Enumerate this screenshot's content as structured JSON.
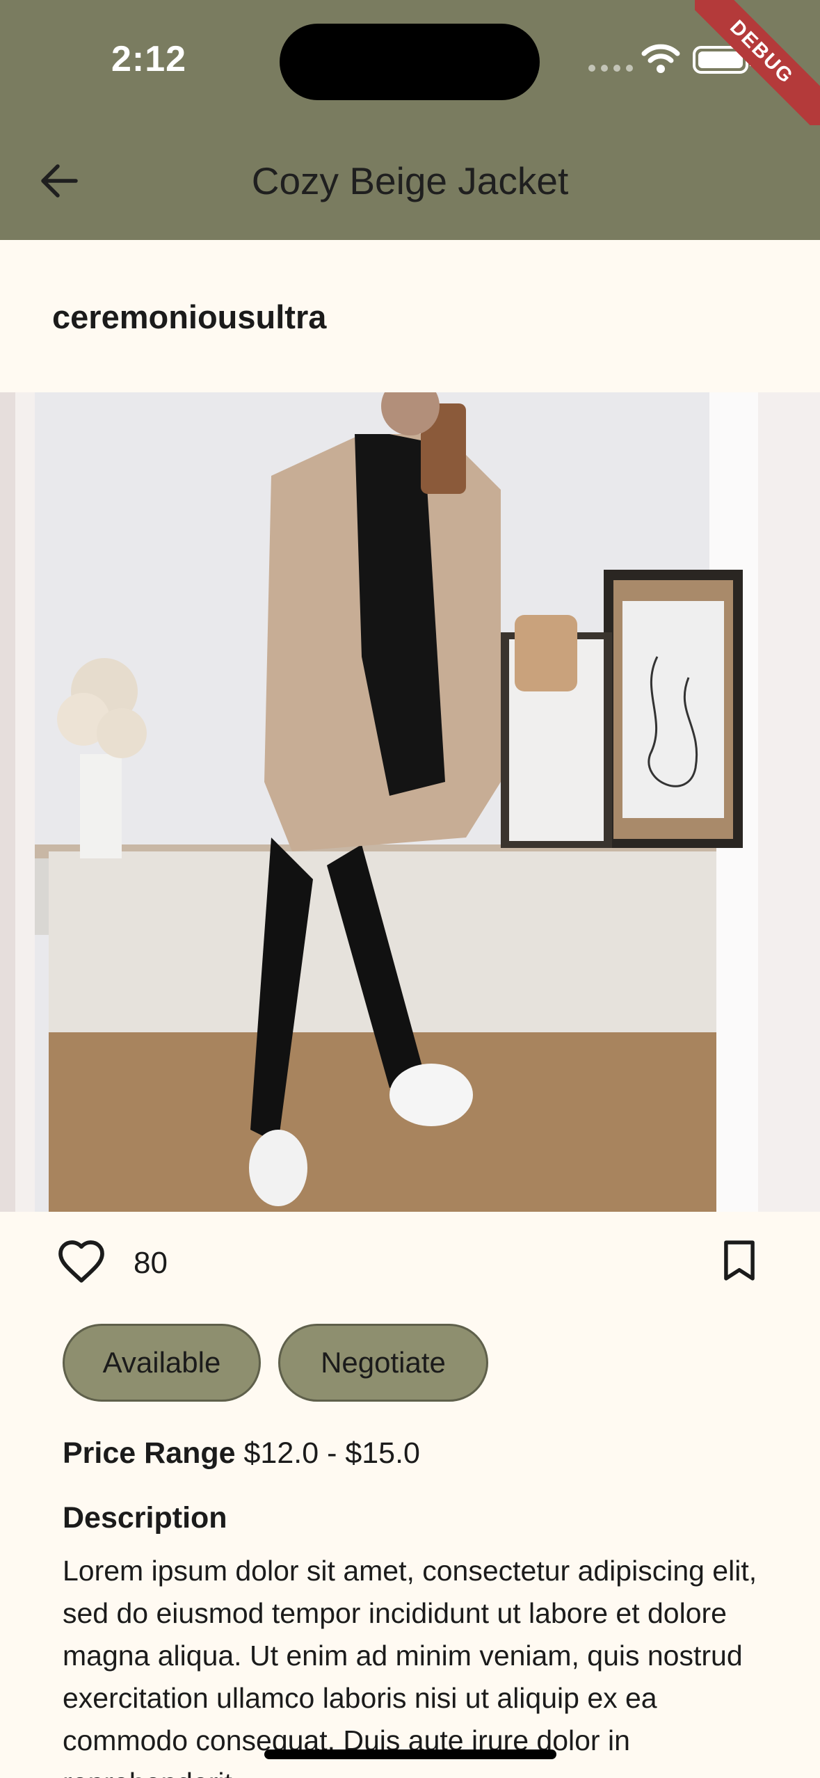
{
  "status_bar": {
    "time": "2:12"
  },
  "debug_label": "DEBUG",
  "app_bar": {
    "title": "Cozy Beige Jacket"
  },
  "seller": {
    "username": "ceremoniousultra"
  },
  "actions": {
    "like_count": "80"
  },
  "chips": {
    "available": "Available",
    "negotiate": "Negotiate"
  },
  "price": {
    "label": "Price Range",
    "value": "$12.0 - $15.0"
  },
  "description": {
    "heading": "Description",
    "text": "Lorem ipsum dolor sit amet, consectetur adipiscing elit, sed do eiusmod tempor incididunt ut labore et dolore magna aliqua. Ut enim ad minim veniam, quis nostrud exercitation ullamco laboris nisi ut aliquip ex ea commodo consequat. Duis aute irure dolor in reprehenderit"
  },
  "colors": {
    "app_bar": "#7A7C60",
    "background": "#FFFAF2",
    "chip": "#8E8F6F",
    "debug": "#B43A3A"
  },
  "icons": [
    "back-arrow-icon",
    "wifi-icon",
    "battery-icon",
    "heart-outline-icon",
    "bookmark-outline-icon"
  ]
}
